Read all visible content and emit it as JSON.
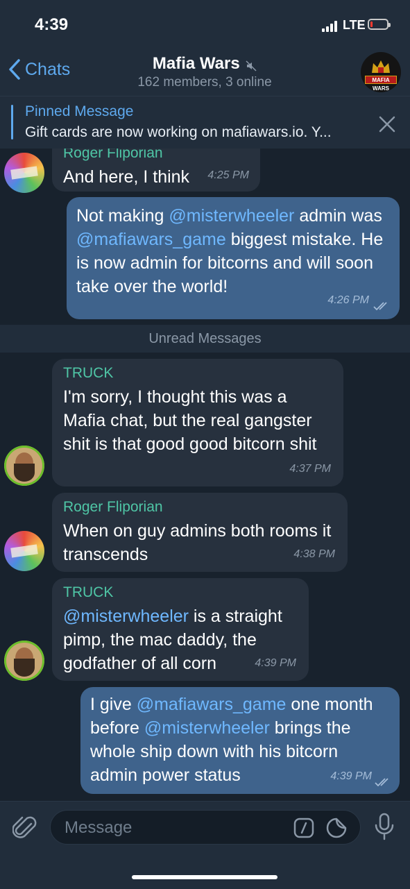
{
  "status": {
    "time": "4:39",
    "network": "LTE"
  },
  "header": {
    "back_label": "Chats",
    "title": "Mafia Wars",
    "subtitle": "162 members, 3 online",
    "avatar_text": "MAFIA WARS"
  },
  "pinned": {
    "title": "Pinned Message",
    "text": "Gift cards are now working on mafiawars.io. Y..."
  },
  "messages": [
    {
      "sender": "Roger Fliporian",
      "text": "And here, I think",
      "time": "4:25 PM"
    },
    {
      "parts": [
        "Not making ",
        "@misterwheeler",
        " admin was ",
        "@mafiawars_game",
        " biggest mistake. He is now admin for bitcorns and will soon take over the world!"
      ],
      "time": "4:26 PM"
    },
    {
      "sender": "TRUCK",
      "text": "I'm sorry, I thought this was a Mafia chat, but the real gangster shit is that good good bitcorn shit",
      "time": "4:37 PM"
    },
    {
      "sender": "Roger Fliporian",
      "text": "When on guy admins both rooms it transcends",
      "time": "4:38 PM"
    },
    {
      "sender": "TRUCK",
      "parts": [
        "@misterwheeler",
        " is a straight pimp, the mac daddy, the godfather of all corn"
      ],
      "time": "4:39 PM"
    },
    {
      "parts": [
        "I give ",
        "@mafiawars_game",
        " one month before ",
        "@misterwheeler",
        " brings the whole ship down with his bitcorn admin power status"
      ],
      "time": "4:39 PM"
    }
  ],
  "unread_label": "Unread Messages",
  "composer": {
    "placeholder": "Message"
  },
  "colors": {
    "accent": "#5ea9ee",
    "outgoing_bubble": "#3f638c",
    "incoming_bubble": "#27313e",
    "sender_name": "#4fc6a6"
  }
}
